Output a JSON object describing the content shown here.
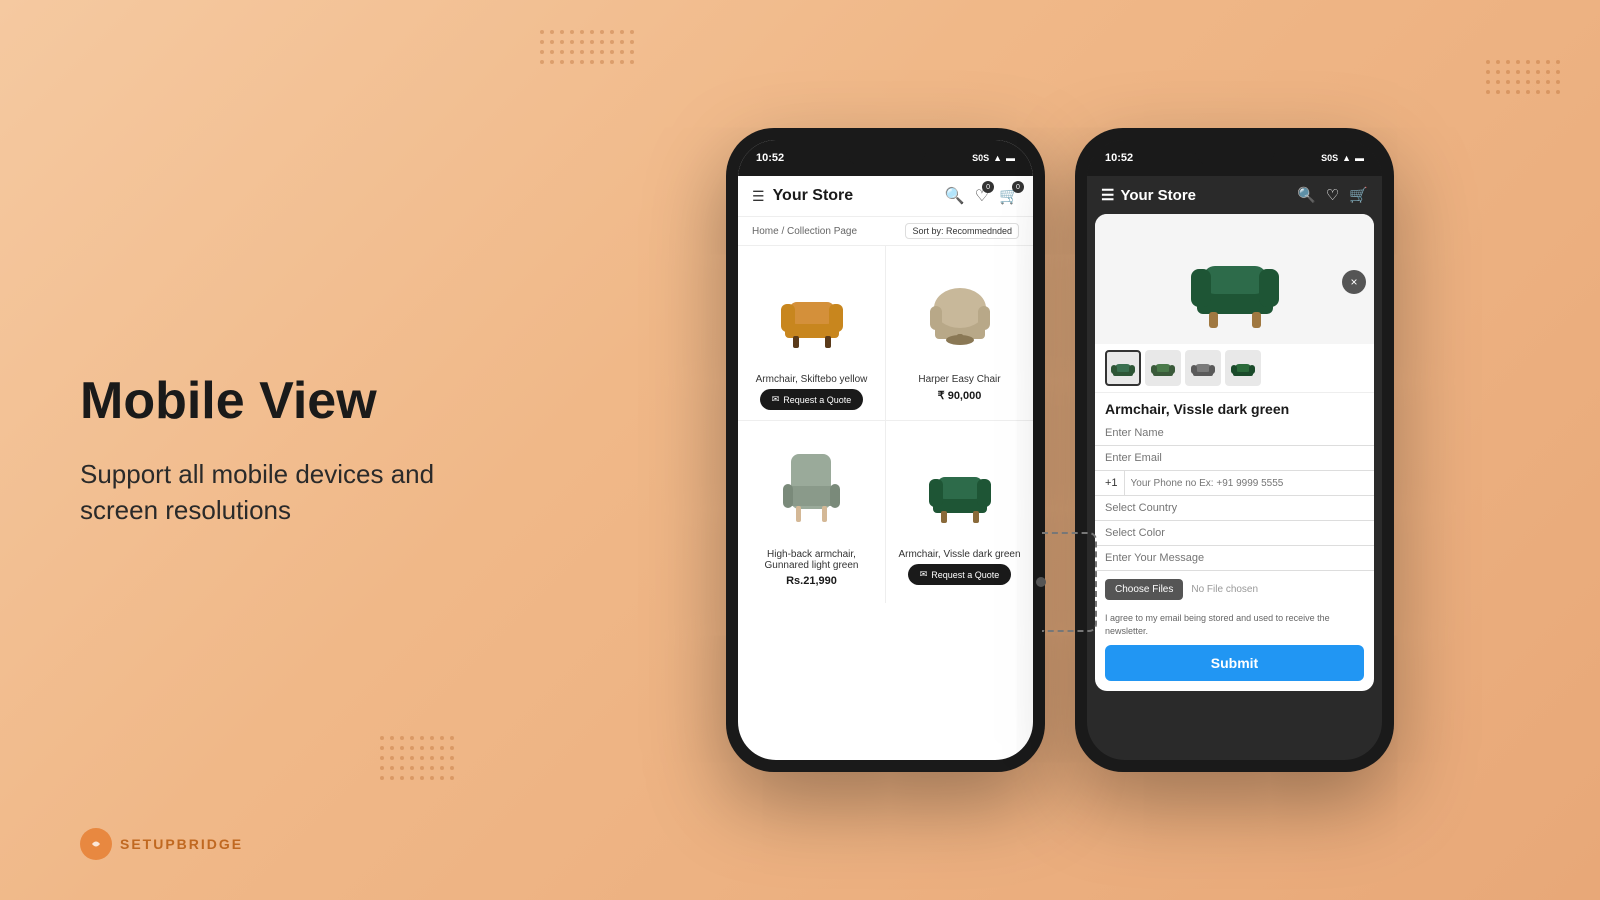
{
  "page": {
    "background": "#f0b888",
    "headline": "Mobile View",
    "subtext": "Support all mobile devices and screen resolutions"
  },
  "logo": {
    "icon": "🔧",
    "text": "SETUPBRIDGE"
  },
  "phone1": {
    "status_time": "10:52",
    "status_right": "S0S",
    "store_title": "Your Store",
    "breadcrumb": "Home / Collection Page",
    "sort_label": "Sort by: Recommednded",
    "products": [
      {
        "name": "Armchair, Skiftebo yellow",
        "price": "",
        "has_btn": true,
        "btn_label": "Request a Quote",
        "color": "#d4903a"
      },
      {
        "name": "Harper Easy Chair",
        "price": "₹ 90,000",
        "has_btn": false,
        "color": "#c8b89a"
      },
      {
        "name": "High-back armchair, Gunnared light green",
        "price": "Rs.21,990",
        "has_btn": false,
        "color": "#9aaa9a"
      },
      {
        "name": "Armchair, Vissle dark green",
        "price": "",
        "has_btn": true,
        "btn_label": "Request a Quote",
        "color": "#2d6b4a"
      }
    ]
  },
  "phone2": {
    "status_time": "10:52",
    "status_right": "S0S",
    "store_title": "Your Store",
    "modal": {
      "product_title": "Armchair, Vissle dark green",
      "close_btn": "×",
      "fields": {
        "name_placeholder": "Enter Name",
        "email_placeholder": "Enter Email",
        "phone_country_code": "+1",
        "phone_placeholder": "Your Phone no Ex: +91 9999 5555",
        "country_placeholder": "Select Country",
        "color_placeholder": "Select Color",
        "message_placeholder": "Enter Your Message",
        "file_btn": "Choose Files",
        "file_status": "No File chosen",
        "consent_text": "I agree to my email being stored and used to receive the newsletter.",
        "submit_label": "Submit"
      }
    }
  }
}
